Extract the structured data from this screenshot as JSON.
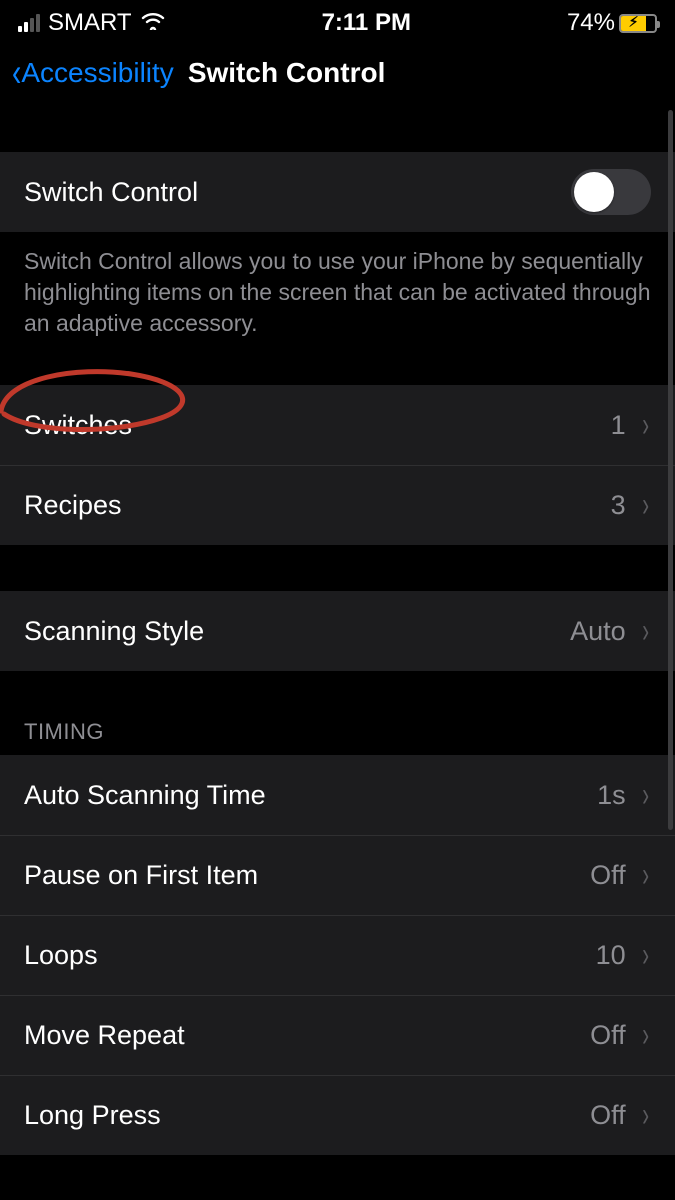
{
  "statusbar": {
    "carrier": "SMART",
    "time": "7:11 PM",
    "battery_pct": "74%"
  },
  "nav": {
    "back_label": "Accessibility",
    "title": "Switch Control"
  },
  "main_toggle": {
    "label": "Switch Control",
    "on": false,
    "footer": "Switch Control allows you to use your iPhone by sequentially highlighting items on the screen that can be activated through an adaptive accessory."
  },
  "group_switches": {
    "switches": {
      "label": "Switches",
      "value": "1"
    },
    "recipes": {
      "label": "Recipes",
      "value": "3"
    }
  },
  "group_scanning": {
    "style": {
      "label": "Scanning Style",
      "value": "Auto"
    }
  },
  "section_timing_header": "TIMING",
  "group_timing": {
    "auto_scan": {
      "label": "Auto Scanning Time",
      "value": "1s"
    },
    "pause_first": {
      "label": "Pause on First Item",
      "value": "Off"
    },
    "loops": {
      "label": "Loops",
      "value": "10"
    },
    "move_repeat": {
      "label": "Move Repeat",
      "value": "Off"
    },
    "long_press": {
      "label": "Long Press",
      "value": "Off"
    }
  },
  "annotation": {
    "target": "switches-row",
    "shape": "circle"
  }
}
